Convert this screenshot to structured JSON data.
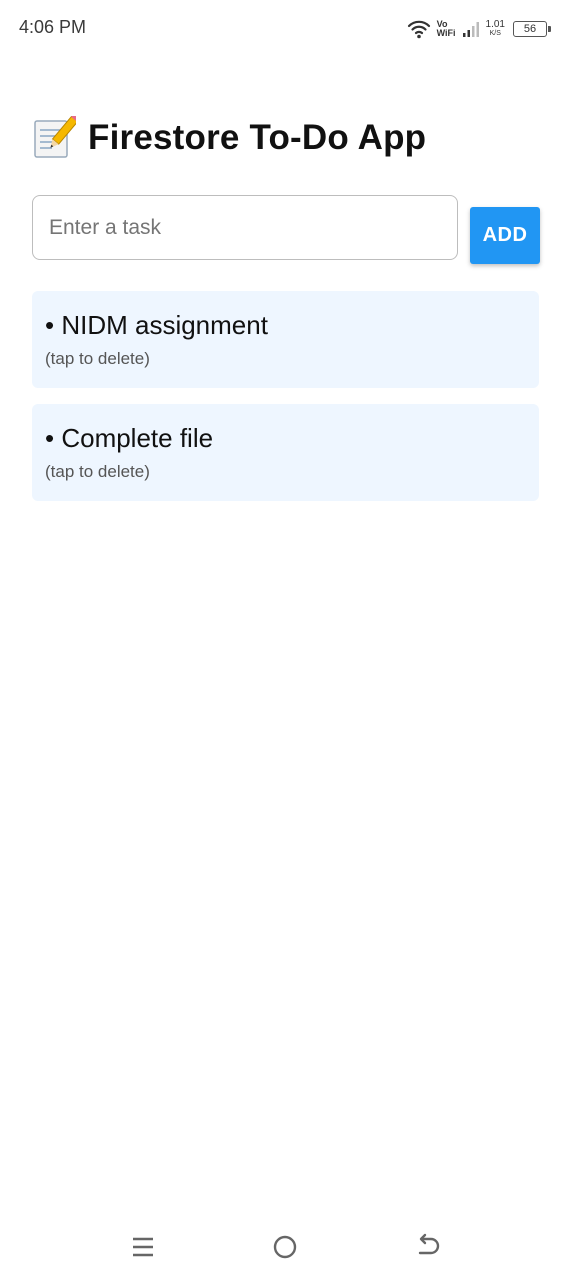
{
  "status_bar": {
    "time": "4:06 PM",
    "vo_top": "Vo",
    "vo_bottom": "WiFi",
    "speed_value": "1.01",
    "speed_unit": "K/S",
    "battery_level": "56"
  },
  "header": {
    "icon": "memo-icon",
    "title": "Firestore To-Do App"
  },
  "task_form": {
    "input_value": "",
    "input_placeholder": "Enter a task",
    "add_label": "ADD"
  },
  "tasks": [
    {
      "title": "• NIDM assignment",
      "hint": "(tap to delete)"
    },
    {
      "title": "• Complete file",
      "hint": "(tap to delete)"
    }
  ],
  "nav_bar": {
    "icons": [
      "menu-icon",
      "home-icon",
      "back-icon"
    ]
  },
  "colors": {
    "accent": "#2196f3",
    "task_background": "#eef6ff",
    "input_border": "#bdbdbd"
  }
}
